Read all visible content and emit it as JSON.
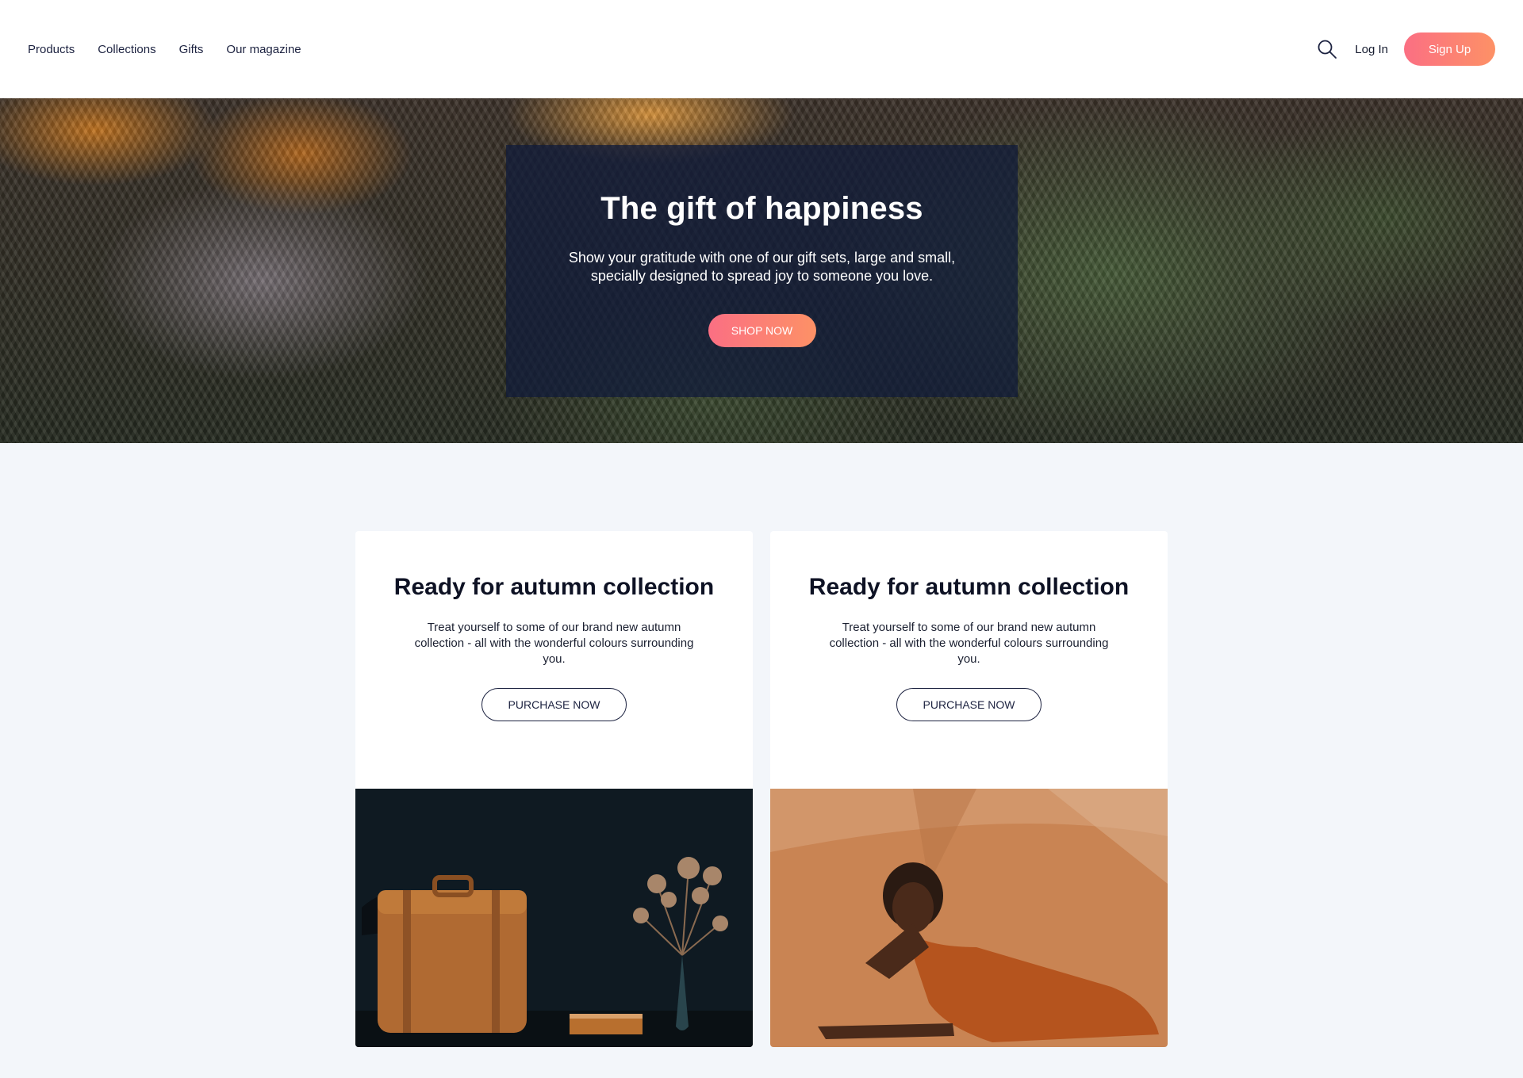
{
  "nav": {
    "items": [
      "Products",
      "Collections",
      "Gifts",
      "Our magazine"
    ],
    "login": "Log In",
    "signup": "Sign Up"
  },
  "hero": {
    "title": "The gift of happiness",
    "text": "Show your gratitude with one of our gift sets, large and small, specially designed to spread joy to someone you love.",
    "button": "SHOP NOW"
  },
  "cards": [
    {
      "title": "Ready for autumn collection",
      "text": "Treat yourself to some of our brand new autumn collection - all with the wonderful colours surrounding you.",
      "button": "PURCHASE NOW"
    },
    {
      "title": "Ready for autumn collection",
      "text": "Treat yourself to some of our brand new autumn collection - all with the wonderful colours surrounding you.",
      "button": "PURCHASE NOW"
    }
  ],
  "colors": {
    "accent_start": "#fb6f83",
    "accent_end": "#fd9166",
    "navy": "#1c2240",
    "page_bg": "#f3f6fa"
  }
}
